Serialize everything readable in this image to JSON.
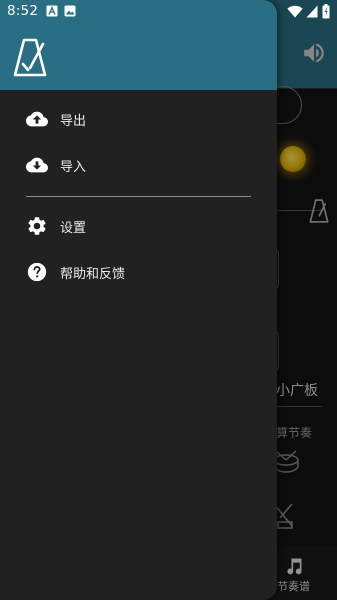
{
  "status_bar": {
    "time": "8:52",
    "icons": [
      "notification-a-icon",
      "notification-image-icon",
      "wifi-icon",
      "signal-icon",
      "battery-icon"
    ]
  },
  "drawer": {
    "logo_icon": "metronome-icon",
    "sections": [
      [
        {
          "icon": "cloud-upload-icon",
          "label": "导出"
        },
        {
          "icon": "cloud-download-icon",
          "label": "导入"
        }
      ],
      [
        {
          "icon": "gear-icon",
          "label": "设置"
        },
        {
          "icon": "help-circle-icon",
          "label": "帮助和反馈"
        }
      ]
    ]
  },
  "background": {
    "partial_label_1": "小广板",
    "partial_label_2": "算节奏",
    "bottom_nav_label": "节奏谱"
  },
  "colors": {
    "header": "#2a6e83",
    "drawer": "#212121",
    "text": "#ececec"
  }
}
